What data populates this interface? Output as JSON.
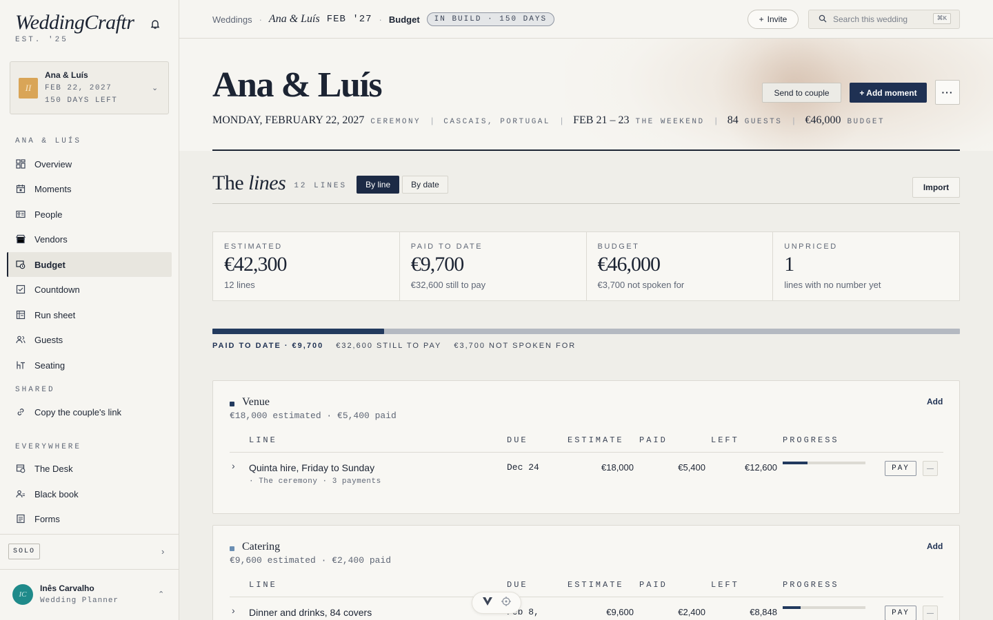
{
  "brand": {
    "name": "WeddingCraftr",
    "est": "EST. '25"
  },
  "wedding_card": {
    "initials": "II",
    "name": "Ana & Luís",
    "date": "FEB 22, 2027",
    "days_left": "150 DAYS LEFT"
  },
  "sidebar": {
    "section_main": "ANA & LUÍS",
    "items": [
      {
        "label": "Overview",
        "icon": "grid-icon"
      },
      {
        "label": "Moments",
        "icon": "calendar-icon"
      },
      {
        "label": "People",
        "icon": "id-card-icon"
      },
      {
        "label": "Vendors",
        "icon": "storefront-icon"
      },
      {
        "label": "Budget",
        "icon": "budget-icon",
        "active": true
      },
      {
        "label": "Countdown",
        "icon": "checklist-icon"
      },
      {
        "label": "Run sheet",
        "icon": "runsheet-icon"
      },
      {
        "label": "Guests",
        "icon": "guests-icon"
      },
      {
        "label": "Seating",
        "icon": "seating-icon"
      }
    ],
    "section_shared": "SHARED",
    "shared_items": [
      {
        "label": "Copy the couple's link",
        "icon": "link-icon"
      }
    ],
    "section_everywhere": "EVERYWHERE",
    "everywhere_items": [
      {
        "label": "The Desk",
        "icon": "desk-icon"
      },
      {
        "label": "Black book",
        "icon": "contacts-icon"
      },
      {
        "label": "Forms",
        "icon": "forms-icon"
      }
    ],
    "solo_label": "SOLO",
    "user": {
      "initials": "IC",
      "name": "Inês Carvalho",
      "role": "Wedding Planner"
    }
  },
  "topbar": {
    "crumb_root": "Weddings",
    "crumb_couple": "Ana & Luís",
    "crumb_date": "FEB '27",
    "crumb_active": "Budget",
    "status": "IN BUILD · 150 DAYS",
    "invite_label": "Invite",
    "search_placeholder": "Search this wedding",
    "search_shortcut": "⌘K"
  },
  "hero": {
    "title": "Ana & Luís",
    "date": "MONDAY, FEBRUARY 22, 2027",
    "date_caption": "CEREMONY",
    "location": "CASCAIS, PORTUGAL",
    "weekend": "FEB 21 – 23",
    "weekend_caption": "THE WEEKEND",
    "guests": "84",
    "guests_caption": "GUESTS",
    "budget": "€46,000",
    "budget_caption": "BUDGET",
    "send_label": "Send to couple",
    "add_moment_label": "+ Add moment",
    "more_label": "···"
  },
  "lines": {
    "title_plain": "The ",
    "title_italic": "lines",
    "count": "12 LINES",
    "view_by_line": "By line",
    "view_by_date": "By date",
    "import_label": "Import"
  },
  "stats": [
    {
      "label": "ESTIMATED",
      "value": "€42,300",
      "sub": "12 lines"
    },
    {
      "label": "PAID TO DATE",
      "value": "€9,700",
      "sub": "€32,600 still to pay"
    },
    {
      "label": "BUDGET",
      "value": "€46,000",
      "sub": "€3,700 not spoken for"
    },
    {
      "label": "UNPRICED",
      "value": "1",
      "sub": "lines with no number yet"
    }
  ],
  "budget_bar": {
    "paid_fraction": 0.23,
    "legend_paid": "PAID TO DATE · €9,700",
    "legend_to_pay": "€32,600 STILL TO PAY",
    "legend_unspoken": "€3,700 NOT SPOKEN FOR"
  },
  "columns": {
    "line": "LINE",
    "due": "DUE",
    "estimate": "ESTIMATE",
    "paid": "PAID",
    "left": "LEFT",
    "progress": "PROGRESS"
  },
  "groups": [
    {
      "name": "Venue",
      "color": "#223a5e",
      "summary": "€18,000 estimated · €5,400 paid",
      "add_label": "Add",
      "row": {
        "name": "Quinta hire, Friday to Sunday",
        "sub": "· The ceremony · 3 payments",
        "due": "Dec 24",
        "estimate": "€18,000",
        "paid": "€5,400",
        "left": "€12,600",
        "progress": 0.3,
        "pay_label": "PAY",
        "more_label": "—"
      }
    },
    {
      "name": "Catering",
      "color": "#6b8fb3",
      "summary": "€9,600 estimated · €2,400 paid",
      "add_label": "Add",
      "row": {
        "name": "Dinner and drinks, 84 covers",
        "sub": "",
        "due": "Feb 8,",
        "estimate": "€9,600",
        "paid": "€2,400",
        "left": "€8,848",
        "progress": 0.22,
        "pay_label": "PAY",
        "more_label": "—"
      }
    }
  ]
}
